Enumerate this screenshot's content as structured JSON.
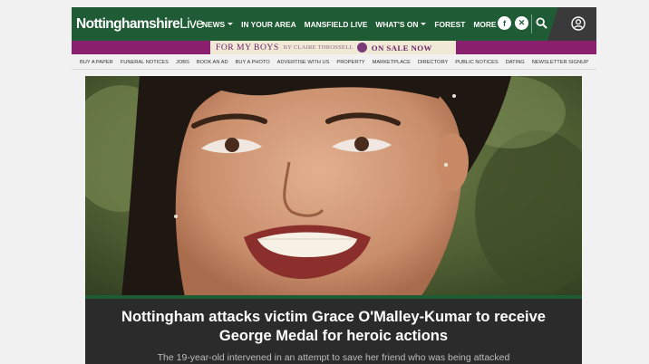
{
  "header": {
    "logo": {
      "part1": "Nottinghamshire",
      "part2": "Live"
    },
    "nav": [
      {
        "label": "NEWS",
        "dropdown": true
      },
      {
        "label": "IN YOUR AREA",
        "dropdown": false
      },
      {
        "label": "MANSFIELD LIVE",
        "dropdown": false
      },
      {
        "label": "WHAT'S ON",
        "dropdown": true
      },
      {
        "label": "FOREST",
        "dropdown": false
      },
      {
        "label": "MORE",
        "dropdown": true
      }
    ],
    "social": {
      "facebook": "f",
      "x": "✕"
    },
    "icons": {
      "search": "search-icon",
      "account": "account-icon"
    },
    "brand_color": "#1f5b34"
  },
  "promo": {
    "title": "FOR MY BOYS",
    "byline": "BY CLAIRE THROSSELL",
    "cta": "ON SALE NOW"
  },
  "subnav": [
    "BUY A PAPER",
    "FUNERAL NOTICES",
    "JOBS",
    "BOOK AN AD",
    "BUY A PHOTO",
    "ADVERTISE WITH US",
    "PROPERTY",
    "MARKETPLACE",
    "DIRECTORY",
    "PUBLIC NOTICES",
    "DATING",
    "NEWSLETTER SIGNUP"
  ],
  "article": {
    "headline": "Nottingham attacks victim Grace O'Malley-Kumar to receive George Medal for heroic actions",
    "standfirst": "The 19-year-old intervened in an attempt to save her friend who was being attacked"
  }
}
